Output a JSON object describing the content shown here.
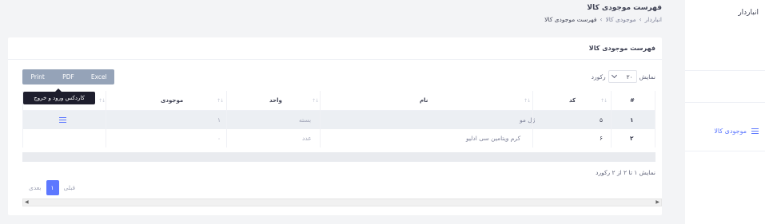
{
  "sidebar": {
    "brand": "انباردار",
    "items": [
      {
        "label": "موجودی کالا",
        "icon": "list-icon"
      }
    ]
  },
  "header": {
    "title": "فهرست موجودی کالا",
    "breadcrumb": [
      "انباردار",
      "موجودی کالا",
      "فهرست موجودی کالا"
    ],
    "separator": "›"
  },
  "card": {
    "title": "فهرست موجودی کالا",
    "export_buttons": [
      "Print",
      "PDF",
      "Excel"
    ],
    "length": {
      "prefix": "نمایش",
      "value": "۲۰",
      "suffix": "رکورد"
    },
    "table": {
      "columns": [
        "#",
        "کد",
        "نام",
        "واحد",
        "موجودی",
        "عملیات"
      ],
      "rows": [
        {
          "index": "۱",
          "code": "۵",
          "name": "ژل مو",
          "unit": "بسته",
          "stock": "۱"
        },
        {
          "index": "۲",
          "code": "۶",
          "name": "کرم ویتامین سی ادلیو",
          "unit": "عدد",
          "stock": "۰"
        }
      ]
    },
    "tooltip": "کاردکس ورود و خروج",
    "info": "نمایش ۱ تا ۲ از ۲ رکورد",
    "pagination": {
      "prev": "قبلی",
      "current": "۱",
      "next": "بعدی"
    }
  },
  "colors": {
    "accent": "#5d78ff",
    "button_bg": "#95a3b8",
    "tooltip_bg": "#1e1e2d"
  }
}
